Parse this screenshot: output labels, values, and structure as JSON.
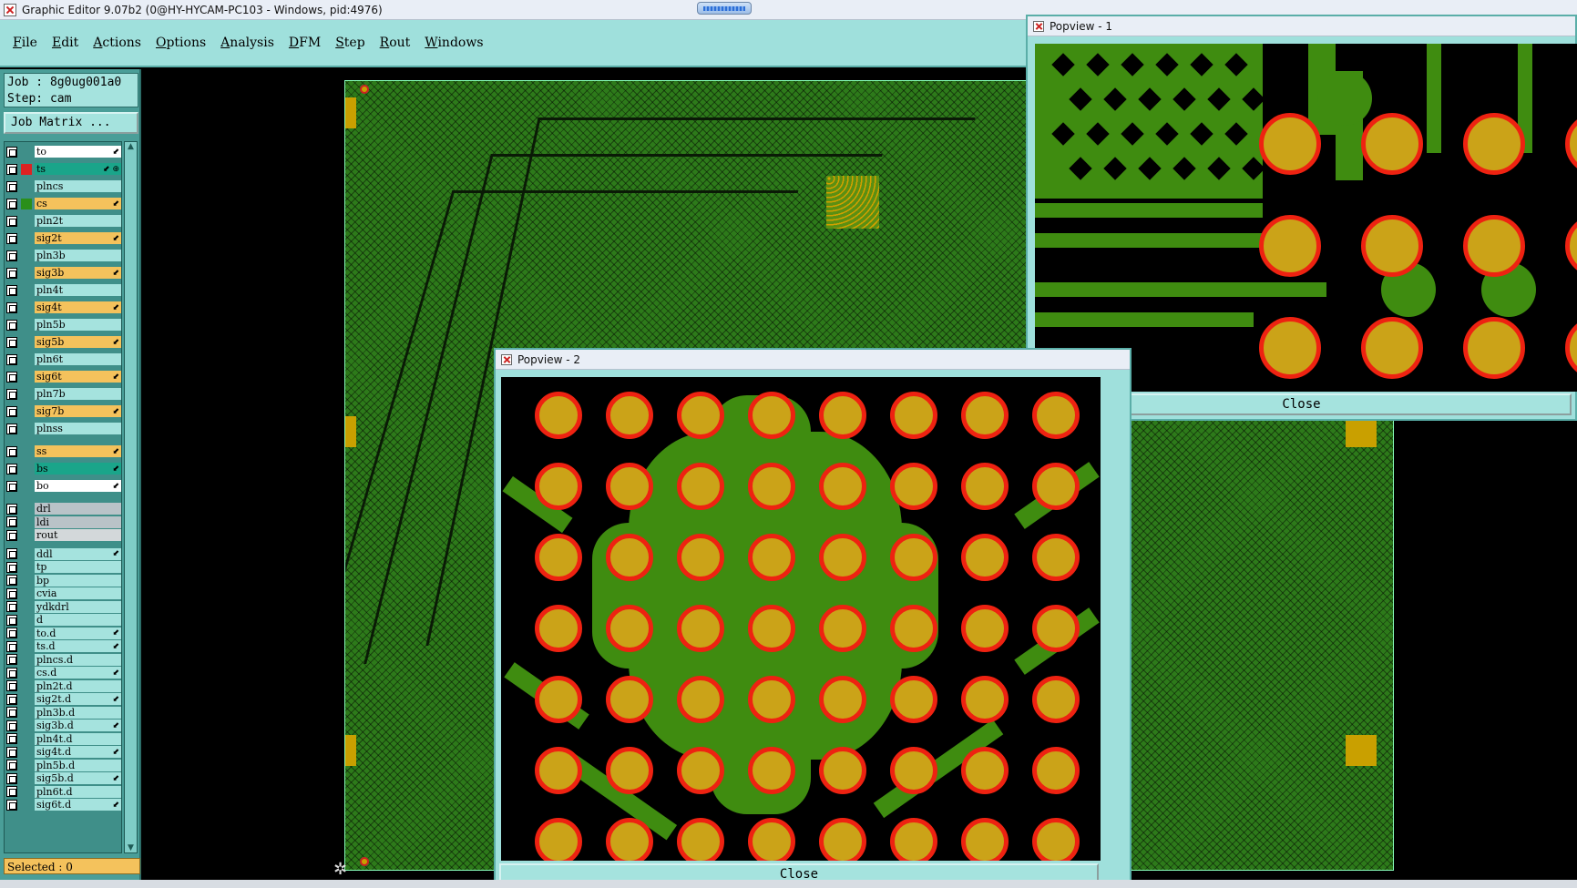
{
  "window": {
    "title": "Graphic Editor 9.07b2 (0@HY-HYCAM-PC103 - Windows, pid:4976)"
  },
  "menu": [
    "File",
    "Edit",
    "Actions",
    "Options",
    "Analysis",
    "DFM",
    "Step",
    "Rout",
    "Windows"
  ],
  "job": {
    "job_line": "Job : 8g0ug001a0",
    "step_line": "Step: cam"
  },
  "job_matrix_label": "Job Matrix ...",
  "layers": [
    {
      "name": "to",
      "color": "#ffffff",
      "mark": "⬋"
    },
    {
      "name": "ts",
      "color": "#1aa58a",
      "mark": "⬋ ⊕"
    },
    {
      "name": "plncs",
      "color": "#a5e3de",
      "mark": ""
    },
    {
      "name": "cs",
      "color": "#f4c25c",
      "mark": "⬋"
    },
    {
      "name": "pln2t",
      "color": "#a5e3de",
      "mark": ""
    },
    {
      "name": "sig2t",
      "color": "#f4c25c",
      "mark": "⬋"
    },
    {
      "name": "pln3b",
      "color": "#a5e3de",
      "mark": ""
    },
    {
      "name": "sig3b",
      "color": "#f4c25c",
      "mark": "⬋"
    },
    {
      "name": "pln4t",
      "color": "#a5e3de",
      "mark": ""
    },
    {
      "name": "sig4t",
      "color": "#f4c25c",
      "mark": "⬋"
    },
    {
      "name": "pln5b",
      "color": "#a5e3de",
      "mark": ""
    },
    {
      "name": "sig5b",
      "color": "#f4c25c",
      "mark": "⬋"
    },
    {
      "name": "pln6t",
      "color": "#a5e3de",
      "mark": ""
    },
    {
      "name": "sig6t",
      "color": "#f4c25c",
      "mark": "⬋"
    },
    {
      "name": "pln7b",
      "color": "#a5e3de",
      "mark": ""
    },
    {
      "name": "sig7b",
      "color": "#f4c25c",
      "mark": "⬋"
    },
    {
      "name": "plnss",
      "color": "#a5e3de",
      "mark": ""
    },
    {
      "name": "ss",
      "color": "#f4c25c",
      "mark": "⬋"
    },
    {
      "name": "bs",
      "color": "#1aa58a",
      "mark": "⬋"
    },
    {
      "name": "bo",
      "color": "#ffffff",
      "mark": "⬋"
    },
    {
      "name": "drl",
      "color": "#b9c3c8",
      "mark": ""
    },
    {
      "name": "ldi",
      "color": "#b9c3c8",
      "mark": ""
    },
    {
      "name": "rout",
      "color": "#d3d8da",
      "mark": ""
    },
    {
      "name": "ddl",
      "color": "#a5e3de",
      "mark": "⬋"
    },
    {
      "name": "tp",
      "color": "#a5e3de",
      "mark": ""
    },
    {
      "name": "bp",
      "color": "#a5e3de",
      "mark": ""
    },
    {
      "name": "cvia",
      "color": "#a5e3de",
      "mark": ""
    },
    {
      "name": "ydkdrl",
      "color": "#a5e3de",
      "mark": ""
    },
    {
      "name": "d",
      "color": "#a5e3de",
      "mark": ""
    },
    {
      "name": "to.d",
      "color": "#a5e3de",
      "mark": "⬋"
    },
    {
      "name": "ts.d",
      "color": "#a5e3de",
      "mark": "⬋"
    },
    {
      "name": "plncs.d",
      "color": "#a5e3de",
      "mark": ""
    },
    {
      "name": "cs.d",
      "color": "#a5e3de",
      "mark": "⬋"
    },
    {
      "name": "pln2t.d",
      "color": "#a5e3de",
      "mark": ""
    },
    {
      "name": "sig2t.d",
      "color": "#a5e3de",
      "mark": "⬋"
    },
    {
      "name": "pln3b.d",
      "color": "#a5e3de",
      "mark": ""
    },
    {
      "name": "sig3b.d",
      "color": "#a5e3de",
      "mark": "⬋"
    },
    {
      "name": "pln4t.d",
      "color": "#a5e3de",
      "mark": ""
    },
    {
      "name": "sig4t.d",
      "color": "#a5e3de",
      "mark": "⬋"
    },
    {
      "name": "pln5b.d",
      "color": "#a5e3de",
      "mark": ""
    },
    {
      "name": "sig5b.d",
      "color": "#a5e3de",
      "mark": "⬋"
    },
    {
      "name": "pln6t.d",
      "color": "#a5e3de",
      "mark": ""
    },
    {
      "name": "sig6t.d",
      "color": "#a5e3de",
      "mark": "⬋"
    }
  ],
  "status": {
    "selected": "Selected : 0"
  },
  "popview1": {
    "title": "Popview - 1",
    "close_label": "Close"
  },
  "popview2": {
    "title": "Popview - 2",
    "close_label": "Close"
  },
  "colors": {
    "panel": "#9fe0dc",
    "via_ring": "#ee2211",
    "via_fill": "#cba318",
    "copper": "#3f8c10"
  }
}
